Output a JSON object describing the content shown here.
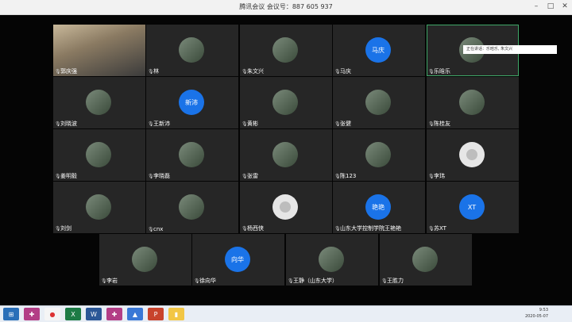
{
  "window": {
    "title": "腾讯会议 会议号：887 605 937"
  },
  "speaking": "正在讲话：乐晗乐, 朱文兴",
  "participants": [
    {
      "name": "郭庆强",
      "avatar": "video",
      "mic": true
    },
    {
      "name": "林",
      "avatar": "photo",
      "mic": true
    },
    {
      "name": "朱文兴",
      "avatar": "photo",
      "mic": true,
      "host": true
    },
    {
      "name": "马庆",
      "avatar": "letter",
      "letter": "马庆",
      "mic": true
    },
    {
      "name": "乐晗乐",
      "avatar": "photo",
      "mic": true,
      "active": true
    },
    {
      "name": "刘晓波",
      "avatar": "photo",
      "mic": true
    },
    {
      "name": "王新沛",
      "avatar": "letter",
      "letter": "新沛",
      "mic": true
    },
    {
      "name": "黄彬",
      "avatar": "photo",
      "mic": true
    },
    {
      "name": "张健",
      "avatar": "photo",
      "mic": true
    },
    {
      "name": "陈桂友",
      "avatar": "photo",
      "mic": true
    },
    {
      "name": "姜明毅",
      "avatar": "photo",
      "mic": true
    },
    {
      "name": "李晓磊",
      "avatar": "photo",
      "mic": true
    },
    {
      "name": "张雷",
      "avatar": "photo",
      "mic": true
    },
    {
      "name": "陈123",
      "avatar": "photo",
      "mic": true
    },
    {
      "name": "李玮",
      "avatar": "placeholder",
      "mic": true
    },
    {
      "name": "刘剑",
      "avatar": "photo",
      "mic": true
    },
    {
      "name": "cnx",
      "avatar": "photo",
      "mic": true
    },
    {
      "name": "杨西侠",
      "avatar": "placeholder",
      "mic": true
    },
    {
      "name": "山东大学控制学院王艳艳",
      "avatar": "letter",
      "letter": "艳艳",
      "mic": true
    },
    {
      "name": "苏XT",
      "avatar": "letter",
      "letter": "XT",
      "mic": true
    },
    {
      "name": "李岩",
      "avatar": "photo",
      "mic": true
    },
    {
      "name": "徐向华",
      "avatar": "letter",
      "letter": "向华",
      "mic": true
    },
    {
      "name": "王静（山东大学）",
      "avatar": "photo",
      "mic": true
    },
    {
      "name": "王胜力",
      "avatar": "photo",
      "mic": true
    }
  ],
  "taskbar": {
    "time": "9:53",
    "date": "2020-05-07",
    "apps": [
      "start-icon",
      "app-icon",
      "chrome-icon",
      "excel-icon",
      "word-icon",
      "app-icon",
      "tencent-meeting-icon",
      "powerpoint-icon",
      "explorer-icon"
    ]
  }
}
